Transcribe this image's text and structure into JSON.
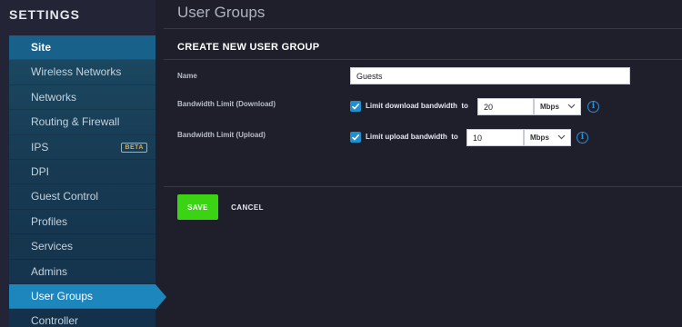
{
  "sidebar": {
    "title": "SETTINGS",
    "items": [
      {
        "label": "Site"
      },
      {
        "label": "Wireless Networks"
      },
      {
        "label": "Networks"
      },
      {
        "label": "Routing & Firewall"
      },
      {
        "label": "IPS",
        "badge": "BETA"
      },
      {
        "label": "DPI"
      },
      {
        "label": "Guest Control"
      },
      {
        "label": "Profiles"
      },
      {
        "label": "Services"
      },
      {
        "label": "Admins"
      },
      {
        "label": "User Groups"
      },
      {
        "label": "Controller"
      }
    ],
    "active_item": "User Groups"
  },
  "page": {
    "title": "User Groups"
  },
  "form": {
    "section_title": "CREATE NEW USER GROUP",
    "name": {
      "label": "Name",
      "value": "Guests"
    },
    "download": {
      "label": "Bandwidth Limit (Download)",
      "checkbox_label": "Limit download bandwidth",
      "to_label": "to",
      "checked": true,
      "value": "20",
      "unit": "Mbps"
    },
    "upload": {
      "label": "Bandwidth Limit (Upload)",
      "checkbox_label": "Limit upload bandwidth",
      "to_label": "to",
      "checked": true,
      "value": "10",
      "unit": "Mbps"
    },
    "save_label": "SAVE",
    "cancel_label": "CANCEL"
  },
  "colors": {
    "accent": "#1c86bd",
    "save": "#3bd414",
    "badge": "#e2a93a",
    "info": "#2f8fd8"
  }
}
